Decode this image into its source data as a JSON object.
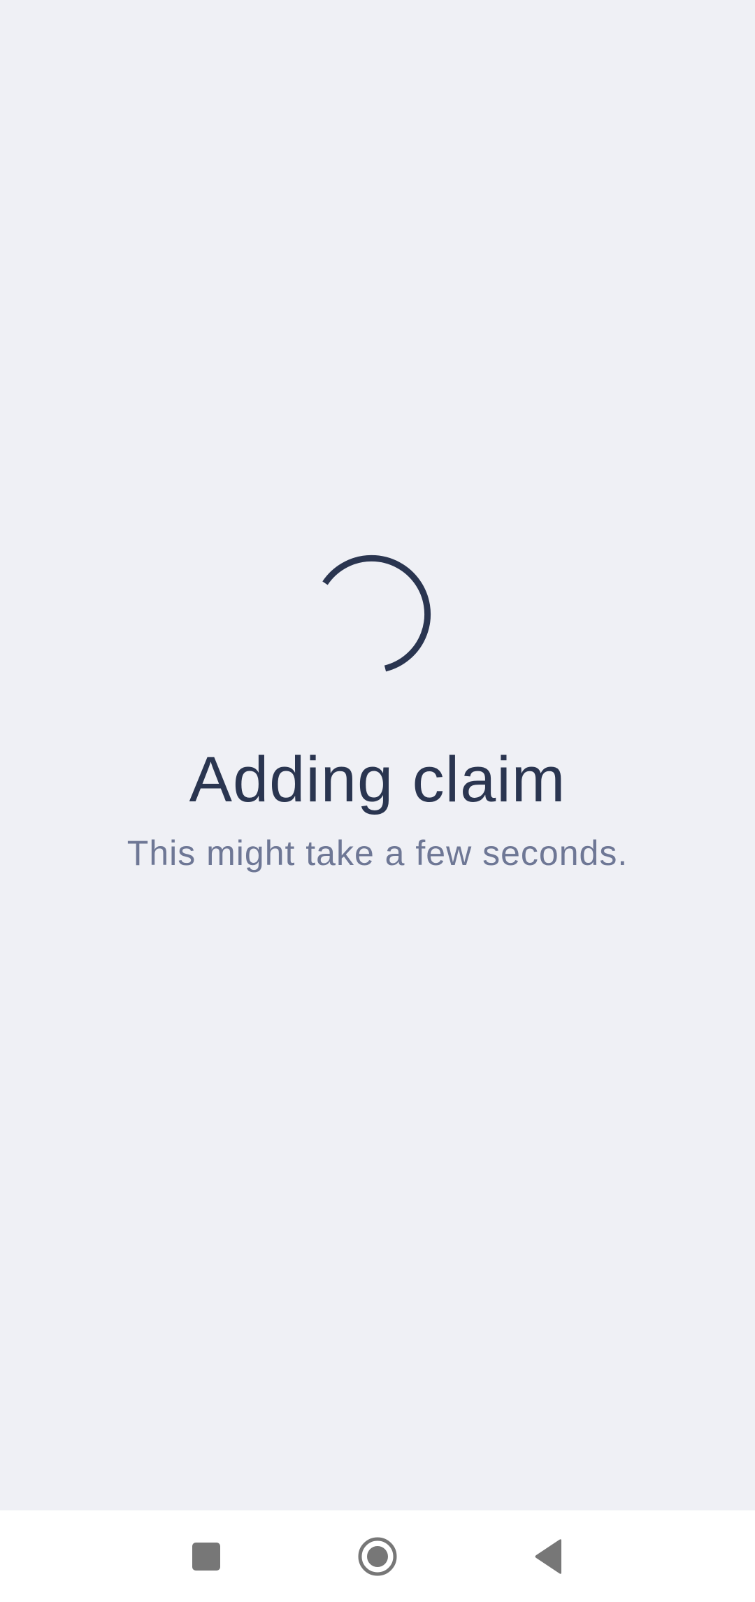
{
  "loading": {
    "title": "Adding claim",
    "subtitle": "This might take a few seconds.",
    "spinner_color": "#2A3550"
  },
  "system_nav": {
    "icons": [
      "recents-icon",
      "home-icon",
      "back-icon"
    ],
    "icon_color": "#777777",
    "background": "#FFFFFF"
  },
  "colors": {
    "background": "#EFF0F5",
    "title": "#2A3550",
    "subtitle": "#6E7795"
  }
}
